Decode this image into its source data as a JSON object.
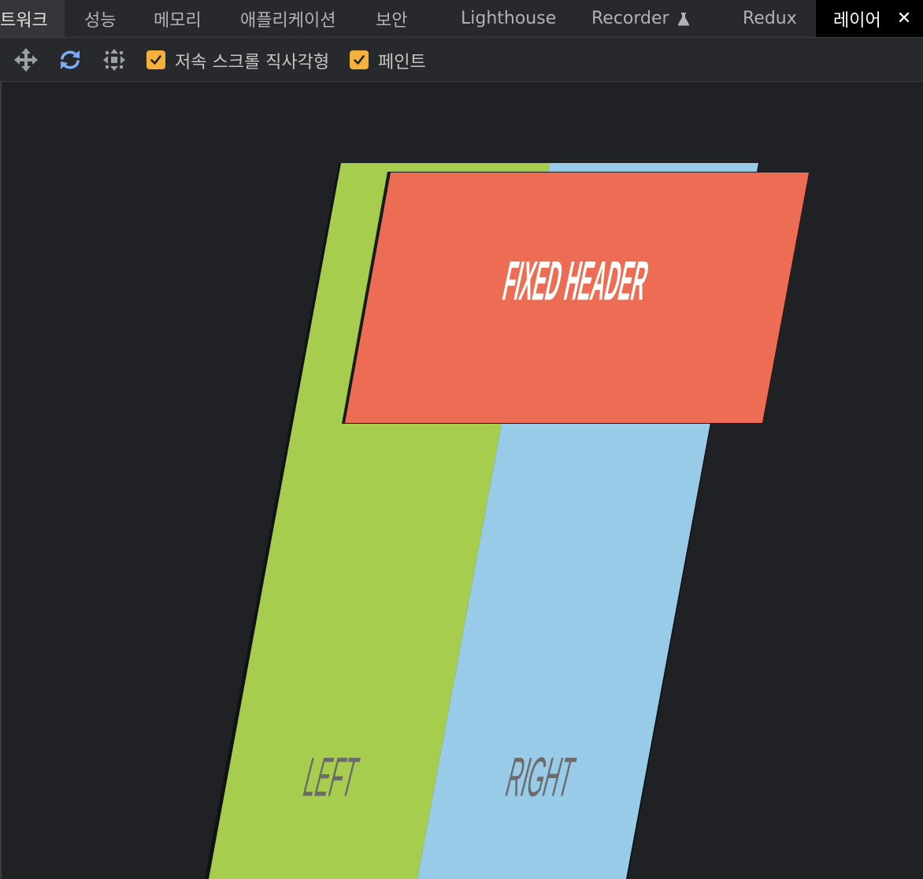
{
  "tabs": [
    {
      "label": "트워크"
    },
    {
      "label": "성능"
    },
    {
      "label": "메모리"
    },
    {
      "label": "애플리케이션"
    },
    {
      "label": "보안"
    },
    {
      "label": "Lighthouse"
    },
    {
      "label": "Recorder"
    },
    {
      "label": "Redux"
    },
    {
      "label": "레이어",
      "active": true
    }
  ],
  "toolbar": {
    "icons": [
      "pan-mode-icon",
      "rotate-mode-icon",
      "reset-transform-icon"
    ],
    "checkboxes": [
      {
        "label": "저속 스크롤 직사각형",
        "checked": true
      },
      {
        "label": "페인트",
        "checked": true
      }
    ]
  },
  "layers": {
    "header_text": "FIXED HEADER",
    "left_text": "LEFT",
    "right_text": "RIGHT",
    "colors": {
      "left": "#a6cd4e",
      "right": "#97cbe8",
      "header": "#ec6d53",
      "accent_checkbox": "#f6b03c",
      "icon_blue": "#7cacf8"
    }
  }
}
